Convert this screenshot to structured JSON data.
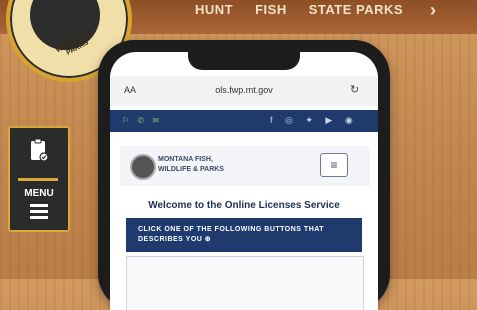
{
  "site": {
    "nav": [
      "HUNT",
      "FISH",
      "STATE PARKS"
    ],
    "nav_more": "›",
    "logo_text": "WILDLIFE & PARKS"
  },
  "side_menu": {
    "label": "MENU",
    "icon": "clipboard-check-icon"
  },
  "browser": {
    "text_size": "AA",
    "url": "ols.fwp.mt.gov",
    "reload_icon": "↻"
  },
  "util_bar": {
    "left_icons": "⚐ ✆ ✉",
    "social_icons": "f ◎ ✦ ▶ ◉"
  },
  "brand": {
    "name_line1": "MONTANA FISH,",
    "name_line2": "WILDLIFE & PARKS",
    "menu_button": "≡"
  },
  "content": {
    "welcome": "Welcome to the Online Licenses Service",
    "banner": "CLICK ONE OF THE FOLLOWING BUTTONS THAT DESCRIBES YOU ⊕"
  },
  "colors": {
    "navy": "#1f3b6e",
    "gold": "#d9a73a"
  }
}
